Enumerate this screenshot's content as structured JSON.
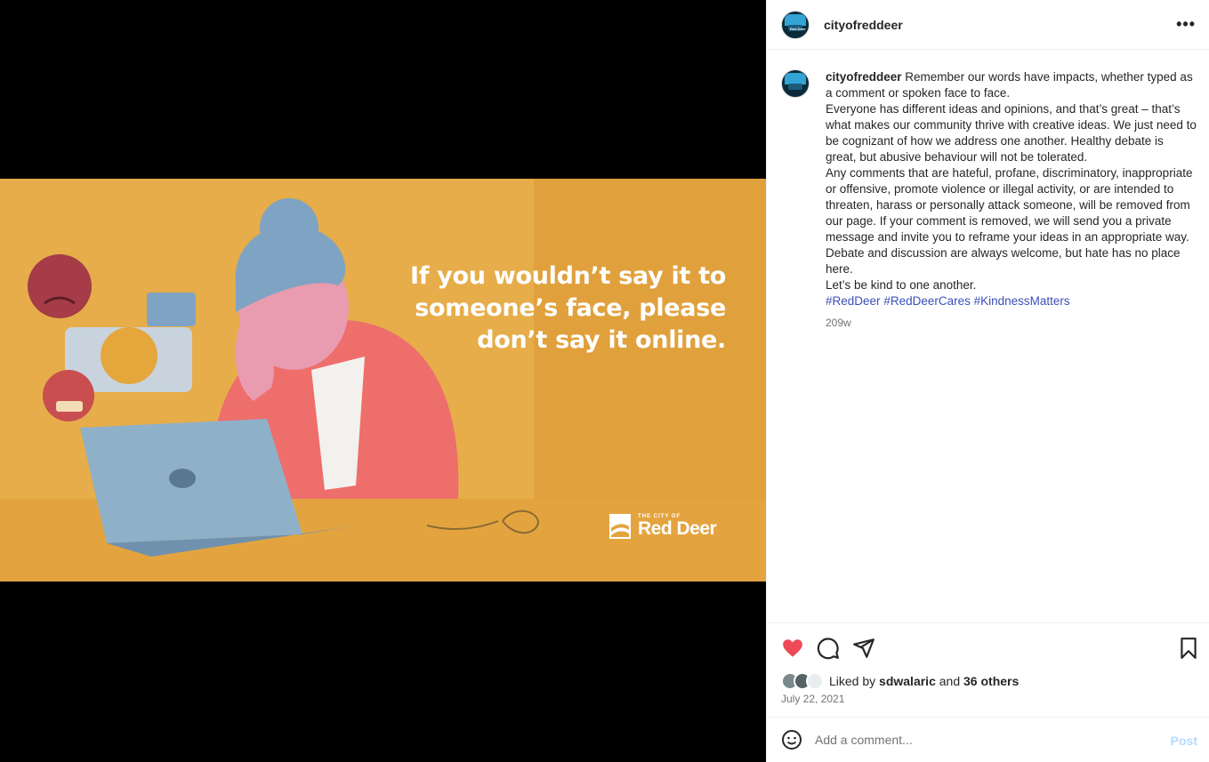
{
  "post": {
    "username": "cityofreddeer",
    "avatar_label": "Red Deer",
    "image": {
      "headline": [
        "If you wouldn’t say it to",
        "someone’s face, please",
        "don’t say it online."
      ],
      "brand_small": "THE CITY OF",
      "brand_name": "Red Deer"
    },
    "caption": {
      "username": "cityofreddeer",
      "paragraphs": [
        "Remember our words have impacts, whether typed as a comment or spoken face to face.",
        "Everyone has different ideas and opinions, and that’s great – that’s what makes our community thrive with creative ideas. We just need to be cognizant of how we address one another. Healthy debate is great, but abusive behaviour will not be tolerated.",
        "Any comments that are hateful, profane, discriminatory, inappropriate or offensive, promote violence or illegal activity, or are intended to threaten, harass or personally attack someone, will be removed from our page. If your comment is removed, we will send you a private message and invite you to reframe your ideas in an appropriate way.",
        "Debate and discussion are always welcome, but hate has no place here.",
        "Let’s be kind to one another."
      ],
      "hashtags": [
        "#RedDeer",
        "#RedDeerCares",
        "#KindnessMatters"
      ],
      "time_ago": "209w"
    },
    "likes": {
      "prefix": "Liked by",
      "user": "sdwalaric",
      "and": "and",
      "others": "36 others"
    },
    "date": "July 22, 2021",
    "comment": {
      "placeholder": "Add a comment...",
      "post_label": "Post"
    },
    "more_label": "•••"
  },
  "icons": {
    "like": "heart-filled-icon",
    "comment": "comment-icon",
    "share": "send-icon",
    "save": "bookmark-icon",
    "emoji": "emoji-icon",
    "more": "more-options-icon"
  },
  "colors": {
    "like": "#ed4956",
    "link": "#3b4fb8",
    "post_button": "#b3dbff",
    "image_bg": "#e6ad4a"
  }
}
